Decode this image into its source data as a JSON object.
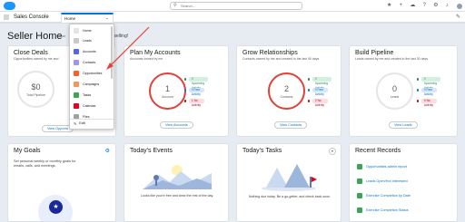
{
  "header": {
    "search_placeholder": "Search...",
    "icons": [
      "favorites-icon",
      "add-icon",
      "setup-icon",
      "help-icon",
      "settings-icon",
      "bell-icon",
      "avatar"
    ]
  },
  "nav": {
    "app_name": "Sales Console",
    "active_tab": "Home"
  },
  "greeting": {
    "title": "Seller Home",
    "sub_left": "Good",
    "sub_right": "et selling!"
  },
  "dropdown": {
    "items": [
      {
        "label": "Home",
        "icon": "home-icon",
        "color": "#f4f6f9"
      },
      {
        "label": "Leads",
        "icon": "leads-icon",
        "color": "#e5e5e5"
      },
      {
        "label": "Accounts",
        "icon": "accounts-icon",
        "color": "#5867e8"
      },
      {
        "label": "Contacts",
        "icon": "contacts-icon",
        "color": "#a094ed"
      },
      {
        "label": "Opportunities",
        "icon": "opportunities-icon",
        "color": "#ff5d2d"
      },
      {
        "label": "Campaigns",
        "icon": "campaigns-icon",
        "color": "#f49756"
      },
      {
        "label": "Tasks",
        "icon": "tasks-icon",
        "color": "#3ba755"
      },
      {
        "label": "Calendar",
        "icon": "calendar-icon",
        "color": "#ea001e"
      },
      {
        "label": "Files",
        "icon": "files-icon",
        "color": "#a0a0a0"
      }
    ],
    "edit_label": "Edit"
  },
  "cards": {
    "close_deals": {
      "title": "Close Deals",
      "subtitle": "Opportunities owned by me and",
      "value": "$0",
      "value_label": "Total Pipeline",
      "button": "View Opportu"
    },
    "plan_accounts": {
      "title": "Plan My Accounts",
      "subtitle": "Accounts owned by me",
      "value": "1",
      "value_label": "Account",
      "button": "View Accounts",
      "activities": [
        {
          "label": "0 Upcoming Activity",
          "color": "#2e844a",
          "bg": "#d0f0e0"
        },
        {
          "label": "0 Past Activity",
          "color": "#0176d3",
          "bg": "#d8e6fe"
        },
        {
          "label": "1 No Activity",
          "color": "#ba0517",
          "bg": "#fddde3"
        }
      ]
    },
    "grow_relationships": {
      "title": "Grow Relationships",
      "subtitle": "Contacts owned by me and created in the last 90 days",
      "value": "2",
      "value_label": "Contacts",
      "button": "View Contacts",
      "activities": [
        {
          "label": "0 Upcoming Activity",
          "color": "#2e844a",
          "bg": "#d0f0e0"
        },
        {
          "label": "0 Past Activity",
          "color": "#0176d3",
          "bg": "#d8e6fe"
        },
        {
          "label": "2 No Activity",
          "color": "#ba0517",
          "bg": "#fddde3"
        }
      ]
    },
    "build_pipeline": {
      "title": "Build Pipeline",
      "subtitle": "Leads owned by me and created in the last 30 days",
      "value": "0",
      "value_label": "Leads",
      "button": "View Leads",
      "activities": [
        {
          "label": "0 Upcoming Activity",
          "color": "#2e844a",
          "bg": "#d0f0e0"
        },
        {
          "label": "0 Past Activity",
          "color": "#0176d3",
          "bg": "#d8e6fe"
        },
        {
          "label": "0 No Activity",
          "color": "#ba0517",
          "bg": "#fddde3"
        }
      ]
    },
    "my_goals": {
      "title": "My Goals",
      "text": "Set personal weekly or monthly goals for emails, calls, and meetings."
    },
    "todays_events": {
      "title": "Today's Events",
      "text": "Looks like you're free and clear the rest of the day."
    },
    "todays_tasks": {
      "title": "Today's Tasks",
      "text": "Nothing due today. Be a go-getter, and check back soon."
    },
    "recent_records": {
      "title": "Recent Records",
      "items": [
        "Opportunities admin report",
        "Leads Open/Hot Interested",
        "Exercise Completion by Date",
        "Exercise Completion Status"
      ]
    }
  },
  "colors": {
    "brand": "#0176d3",
    "ring_highlight": "#e0413b",
    "background": "#e6ecf2"
  }
}
